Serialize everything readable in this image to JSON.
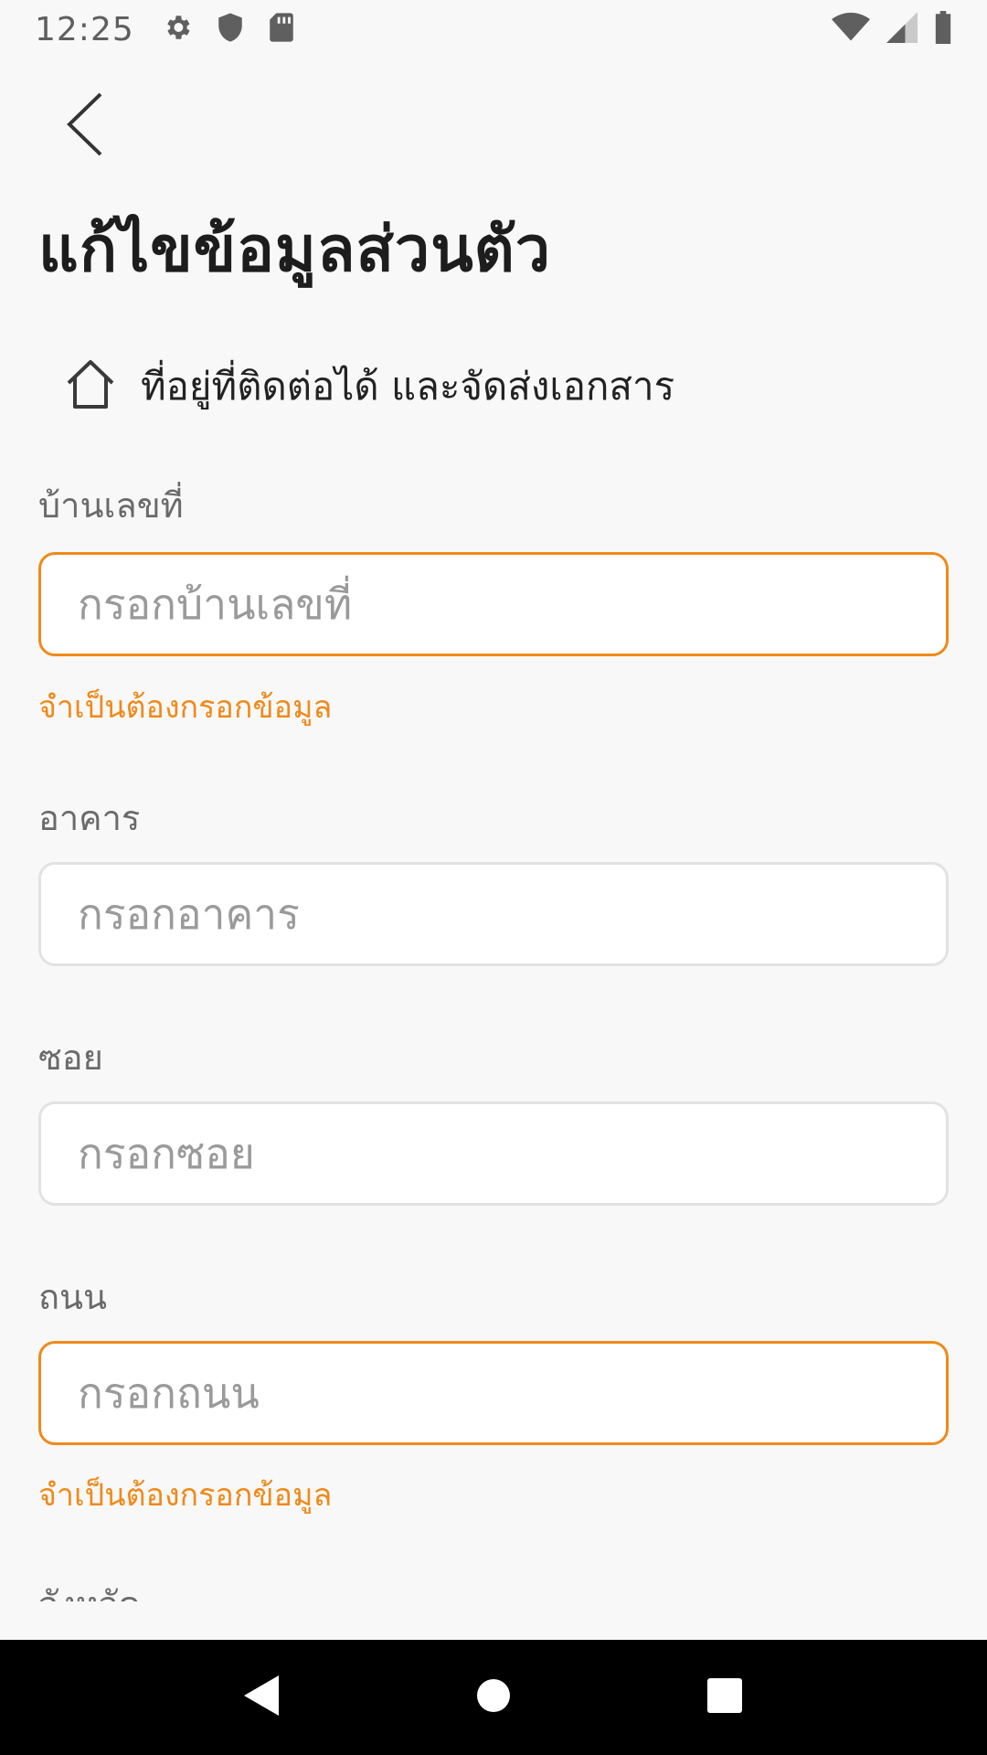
{
  "status_bar": {
    "time": "12:25",
    "left_icons": [
      "gear-icon",
      "shield-icon",
      "sd-card-icon"
    ],
    "right_icons": [
      "wifi-icon",
      "cell-signal-icon",
      "battery-icon"
    ]
  },
  "header": {
    "title": "แก้ไขข้อมูลส่วนตัว",
    "back_icon": "chevron-left-icon"
  },
  "section": {
    "icon": "home-icon",
    "title": "ที่อยู่ที่ติดต่อได้ และจัดส่งเอกสาร"
  },
  "fields": {
    "house_number": {
      "label": "บ้านเลขที่",
      "placeholder": "กรอกบ้านเลขที่",
      "value": "",
      "error": "จำเป็นต้องกรอกข้อมูล"
    },
    "building": {
      "label": "อาคาร",
      "placeholder": "กรอกอาคาร",
      "value": ""
    },
    "soi": {
      "label": "ซอย",
      "placeholder": "กรอกซอย",
      "value": ""
    },
    "road": {
      "label": "ถนน",
      "placeholder": "กรอกถนน",
      "value": "",
      "error": "จำเป็นต้องกรอกข้อมูล"
    },
    "province": {
      "label": "จังหวัด"
    }
  },
  "colors": {
    "accent": "#ef8a1b",
    "background": "#f8f8f8",
    "input_border": "#e2e2e2"
  },
  "nav_bar": {
    "buttons": [
      "back-triangle-icon",
      "home-circle-icon",
      "recents-square-icon"
    ]
  }
}
